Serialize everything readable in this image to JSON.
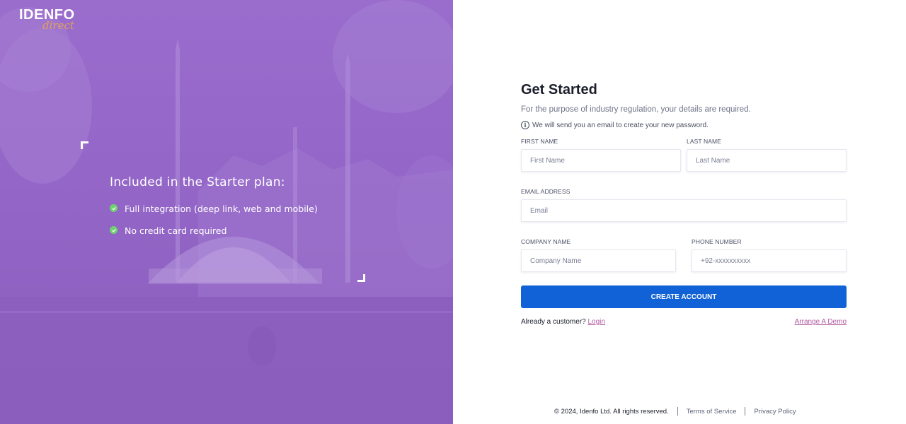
{
  "brand": {
    "logo_main": "IDENFO",
    "logo_sub": "direct"
  },
  "plan": {
    "title": "Included in the Starter plan:",
    "items": [
      {
        "label": "Full integration (deep link, web and mobile)",
        "icon": "check-circle-icon"
      },
      {
        "label": "No credit card required",
        "icon": "check-circle-icon"
      }
    ]
  },
  "form": {
    "title": "Get Started",
    "subtitle": "For the purpose of industry regulation, your details are required.",
    "info": "We will send you an email to create your new password.",
    "first_name": {
      "label": "FIRST NAME",
      "placeholder": "First Name"
    },
    "last_name": {
      "label": "LAST NAME",
      "placeholder": "Last Name"
    },
    "email": {
      "label": "EMAIL ADDRESS",
      "placeholder": "Email"
    },
    "company": {
      "label": "COMPANY NAME",
      "placeholder": "Company Name"
    },
    "phone": {
      "label": "PHONE NUMBER",
      "placeholder": "+92-xxxxxxxxxx"
    },
    "submit_label": "CREATE ACCOUNT",
    "already_customer": "Already a customer?",
    "login_link": "Login",
    "demo_link": "Arrange A Demo"
  },
  "footer": {
    "copyright": "© 2024, Idenfo Ltd. All rights reserved.",
    "terms": "Terms of Service",
    "privacy": "Privacy Policy"
  },
  "colors": {
    "panel_purple": "#9466c8",
    "primary_button": "#1162d6",
    "link_pink": "#b05aa0",
    "check_green": "#6fd36f"
  }
}
